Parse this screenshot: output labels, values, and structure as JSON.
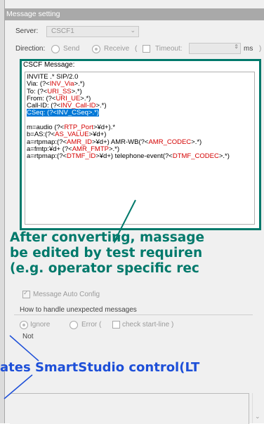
{
  "dialog": {
    "title": "Message setting"
  },
  "server": {
    "label": "Server:",
    "value": "CSCF1"
  },
  "direction": {
    "label": "Direction:",
    "send": "Send",
    "receive": "Receive",
    "paren_open": "(",
    "timeout_label": "Timeout:",
    "unit": "ms",
    "paren_close": ")"
  },
  "message": {
    "label": "CSCF Message:",
    "lines": [
      "INVITE .* SIP/2.0",
      "Via: (?<INV_Via>.*)",
      "To: (?<URI_SS>.*)",
      "From: (?<URI_UE>.*)",
      "Call-ID: (?<INV_Call-ID>.*)",
      "CSeq: (?<INV_CSeq>.*)",
      "",
      "m=audio (?<RTP_Port>¥d+).*",
      "b=AS:(?<AS_VALUE>¥d+)",
      "a=rtpmap:(?<AMR_ID>¥d+) AMR-WB(?<AMR_CODEC>.*)",
      "a=fmtp:¥d+ (?<AMR_FMTP>.*)",
      "a=rtpmap:(?<DTMF_ID>¥d+) telephone-event(?<DTMF_CODEC>.*)"
    ]
  },
  "callout": {
    "line1": "After converting, massage",
    "line2": "be edited by test requiren",
    "line3": "(e.g. operator specific rec"
  },
  "auto_config": {
    "label": "Message Auto Config"
  },
  "unexpected": {
    "label": "How to handle unexpected messages",
    "ignore": "Ignore",
    "error": "Error (",
    "check_start_line": "check start-line )"
  },
  "note": {
    "label": "Not"
  },
  "caption": {
    "text": "ates SmartStudio control(LT"
  },
  "colors": {
    "accent": "#00796b",
    "caption": "#1d4fd8",
    "regex": "#d40000",
    "selection": "#0078d7"
  }
}
